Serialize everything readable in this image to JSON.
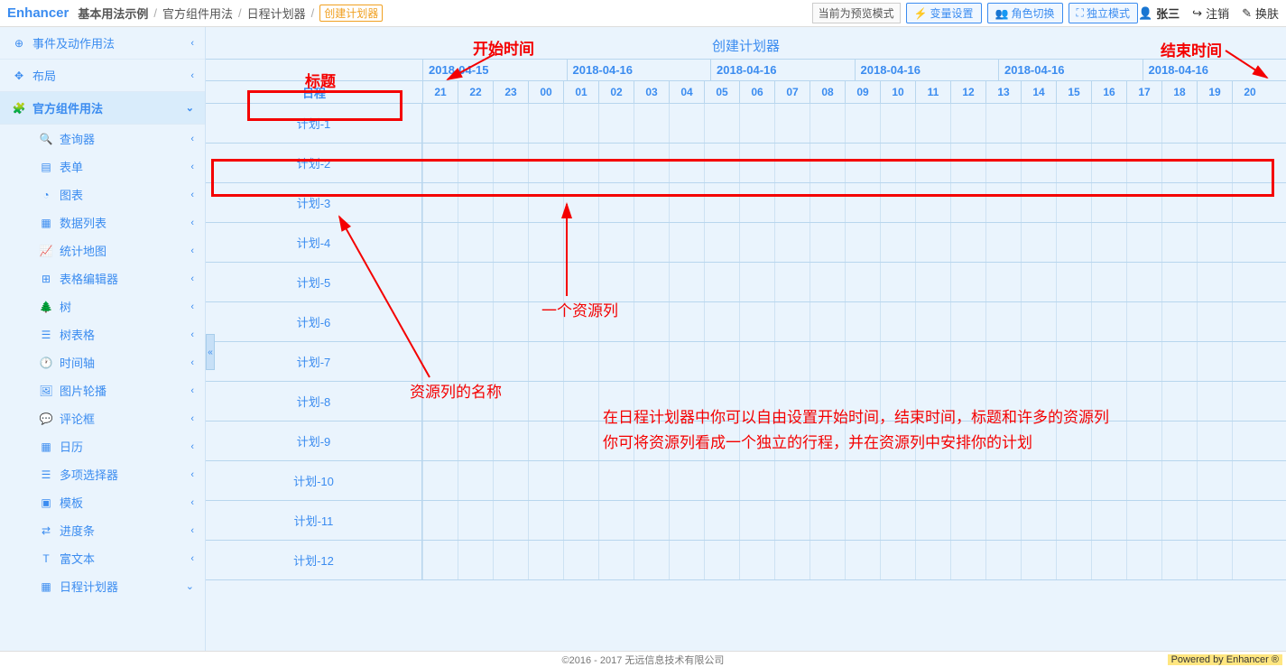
{
  "logo": "Enhancer",
  "breadcrumb": {
    "root": "基本用法示例",
    "level1": "官方组件用法",
    "level2": "日程计划器",
    "active": "创建计划器"
  },
  "topcenter": {
    "preview": "当前为预览模式",
    "var_set": "变量设置",
    "role_switch": "角色切换",
    "standalone": "独立模式"
  },
  "topright": {
    "user": "张三",
    "logout": "注销",
    "skin": "换肤"
  },
  "sidebar": {
    "events": "事件及动作用法",
    "layout": "布局",
    "widgets": "官方组件用法",
    "items": [
      {
        "icon": "search",
        "label": "查询器"
      },
      {
        "icon": "form",
        "label": "表单"
      },
      {
        "icon": "chart",
        "label": "图表"
      },
      {
        "icon": "datalist",
        "label": "数据列表"
      },
      {
        "icon": "map",
        "label": "统计地图"
      },
      {
        "icon": "tableedit",
        "label": "表格编辑器"
      },
      {
        "icon": "tree",
        "label": "树"
      },
      {
        "icon": "treegrid",
        "label": "树表格"
      },
      {
        "icon": "timeline",
        "label": "时间轴"
      },
      {
        "icon": "carousel",
        "label": "图片轮播"
      },
      {
        "icon": "comment",
        "label": "评论框"
      },
      {
        "icon": "calendar",
        "label": "日历"
      },
      {
        "icon": "multisel",
        "label": "多项选择器"
      },
      {
        "icon": "template",
        "label": "模板"
      },
      {
        "icon": "progress",
        "label": "进度条"
      },
      {
        "icon": "richtext",
        "label": "富文本"
      },
      {
        "icon": "scheduler",
        "label": "日程计划器"
      }
    ]
  },
  "scheduler": {
    "title": "创建计划器",
    "res_header": "日程",
    "dates": [
      "2018-04-15",
      "2018-04-16",
      "2018-04-16",
      "2018-04-16",
      "2018-04-16",
      "2018-04-16"
    ],
    "hours": [
      "21",
      "22",
      "23",
      "00",
      "01",
      "02",
      "03",
      "04",
      "05",
      "06",
      "07",
      "08",
      "09",
      "10",
      "11",
      "12",
      "13",
      "14",
      "15",
      "16",
      "17",
      "18",
      "19",
      "20"
    ],
    "resources": [
      "计划-1",
      "计划-2",
      "计划-3",
      "计划-4",
      "计划-5",
      "计划-6",
      "计划-7",
      "计划-8",
      "计划-9",
      "计划-10",
      "计划-11",
      "计划-12"
    ]
  },
  "annotations": {
    "title": "标题",
    "start_time": "开始时间",
    "end_time": "结束时间",
    "resource_col": "一个资源列",
    "resource_name": "资源列的名称",
    "desc1": "在日程计划器中你可以自由设置开始时间，结束时间，标题和许多的资源列",
    "desc2": "你可将资源列看成一个独立的行程，并在资源列中安排你的计划"
  },
  "footer": {
    "copyright": "©2016 - 2017 无远信息技术有限公司",
    "powered": "Powered by Enhancer ®"
  }
}
